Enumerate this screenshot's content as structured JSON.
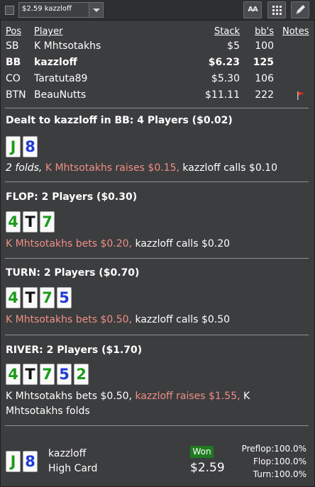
{
  "toolbar": {
    "hand_select_value": "$2.59 kazzloff",
    "font_button_label": "AA"
  },
  "players": {
    "headers": {
      "pos": "Pos",
      "player": "Player",
      "stack": "Stack",
      "bbs": "bb's",
      "notes": "Notes"
    },
    "rows": [
      {
        "pos": "SB",
        "name": "K Mhtsotakhs",
        "stack": "$5",
        "bbs": "100"
      },
      {
        "pos": "BB",
        "name": "kazzloff",
        "stack": "$6.23",
        "bbs": "125"
      },
      {
        "pos": "CO",
        "name": "Taratuta89",
        "stack": "$5.30",
        "bbs": "106"
      },
      {
        "pos": "BTN",
        "name": "BeauNutts",
        "stack": "$11.11",
        "bbs": "222"
      }
    ]
  },
  "preflop": {
    "title": "Dealt to kazzloff in BB: 4 Players ($0.02)",
    "cards": [
      {
        "rank": "J",
        "suit": "c"
      },
      {
        "rank": "8",
        "suit": "d"
      }
    ],
    "actions": {
      "folds": "2 folds,",
      "raise": "K Mhtsotakhs raises $0.15,",
      "call": "kazzloff calls $0.10"
    }
  },
  "flop": {
    "title": "FLOP: 2 Players ($0.30)",
    "cards": [
      {
        "rank": "4",
        "suit": "c"
      },
      {
        "rank": "T",
        "suit": "s"
      },
      {
        "rank": "7",
        "suit": "c"
      }
    ],
    "actions": {
      "bet": "K Mhtsotakhs bets $0.20,",
      "call": "kazzloff calls $0.20"
    }
  },
  "turn": {
    "title": "TURN: 2 Players ($0.70)",
    "cards": [
      {
        "rank": "4",
        "suit": "c"
      },
      {
        "rank": "T",
        "suit": "s"
      },
      {
        "rank": "7",
        "suit": "c"
      },
      {
        "rank": "5",
        "suit": "d"
      }
    ],
    "actions": {
      "bet": "K Mhtsotakhs bets $0.50,",
      "call": "kazzloff calls $0.50"
    }
  },
  "river": {
    "title": "RIVER: 2 Players ($1.70)",
    "cards": [
      {
        "rank": "4",
        "suit": "c"
      },
      {
        "rank": "T",
        "suit": "s"
      },
      {
        "rank": "7",
        "suit": "c"
      },
      {
        "rank": "5",
        "suit": "d"
      },
      {
        "rank": "2",
        "suit": "c"
      }
    ],
    "actions": {
      "bet": "K Mhtsotakhs bets $0.50,",
      "raise": "kazzloff raises $1.55,",
      "fold": "K Mhtsotakhs folds"
    }
  },
  "result": {
    "cards": [
      {
        "rank": "J",
        "suit": "c"
      },
      {
        "rank": "8",
        "suit": "d"
      }
    ],
    "player": "kazzloff",
    "hand": "High Card",
    "badge": "Won",
    "amount": "$2.59",
    "equity": {
      "preflop": "Preflop:100.0%",
      "flop": "Flop:100.0%",
      "turn": "Turn:100.0%"
    }
  },
  "colors": {
    "background": "#3c3d3f",
    "action_highlight": "#ef8f86",
    "won_badge": "#1f7a1f",
    "suit_spades": "#111111",
    "suit_hearts": "#c21e1e",
    "suit_diamonds": "#1f3ad6",
    "suit_clubs": "#1d9b1d"
  },
  "icons": {
    "flag": "red-flag-icon",
    "grid": "grid-icon",
    "edit": "pencil-icon",
    "dropdown": "chevron-down-icon",
    "checkbox": "checkbox"
  }
}
